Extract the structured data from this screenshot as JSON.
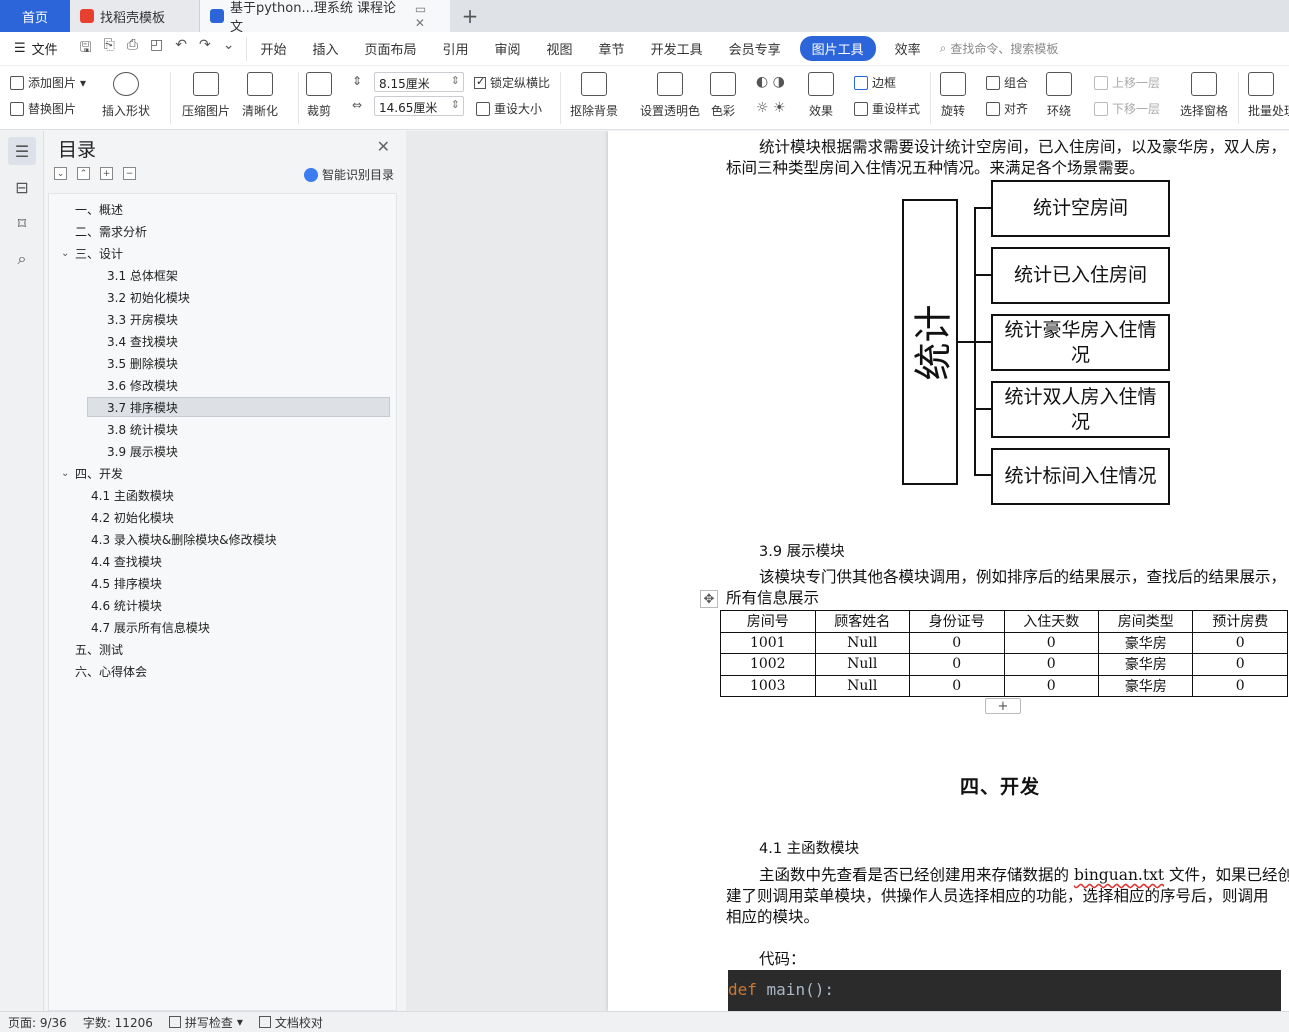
{
  "tabs": {
    "home": "首页",
    "doc1": "找稻壳模板",
    "doc2": "基于python...理系统 课程论文"
  },
  "menu": {
    "file": "文件",
    "items": [
      "开始",
      "插入",
      "页面布局",
      "引用",
      "审阅",
      "视图",
      "章节",
      "开发工具",
      "会员专享",
      "图片工具",
      "效率"
    ],
    "search_placeholder": "查找命令、搜索模板"
  },
  "ribbon": {
    "add_image": "添加图片",
    "replace_image": "替换图片",
    "insert_shape": "插入形状",
    "compress": "压缩图片",
    "clarity": "清晰化",
    "crop": "裁剪",
    "width": "8.15厘米",
    "height": "14.65厘米",
    "lock_ratio": "锁定纵横比",
    "reset_size": "重设大小",
    "remove_bg": "抠除背景",
    "transparent": "设置透明色",
    "color": "色彩",
    "effect": "效果",
    "border": "边框",
    "reset_style": "重设样式",
    "rotate": "旋转",
    "group": "组合",
    "align": "对齐",
    "up_layer": "上移一层",
    "down_layer": "下移一层",
    "wrap": "环绕",
    "select_pane": "选择窗格",
    "batch": "批量处理"
  },
  "toc": {
    "title": "目录",
    "smart": "智能识别目录",
    "items": [
      "一、概述",
      "二、需求分析",
      "三、设计",
      "3.1 总体框架",
      "3.2 初始化模块",
      "3.3 开房模块",
      "3.4 查找模块",
      "3.5 删除模块",
      "3.6 修改模块",
      "3.7 排序模块",
      "3.8 统计模块",
      "3.9 展示模块",
      "四、开发",
      "4.1 主函数模块",
      "4.2 初始化模块",
      "4.3 录入模块&删除模块&修改模块",
      "4.4 查找模块",
      "4.5 排序模块",
      "4.6 统计模块",
      "4.7 展示所有信息模块",
      "五、测试",
      "六、心得体会"
    ]
  },
  "doc": {
    "stat_para_1": "统计模块根据需求需要设计统计空房间，已入住房间，以及豪华房，双人房，",
    "stat_para_2": "标间三种类型房间入住情况五种情况。来满足各个场景需要。",
    "diagram": {
      "main": "统计",
      "boxes": [
        "统计空房间",
        "统计已入住房间",
        "统计豪华房入住情况",
        "统计双人房入住情况",
        "统计标间入住情况"
      ]
    },
    "h_3_9": "3.9 展示模块",
    "show_para_1": "该模块专门供其他各模块调用，例如排序后的结果展示，查找后的结果展示，",
    "show_para_2": "所有信息展示",
    "table": {
      "headers": [
        "房间号",
        "顾客姓名",
        "身份证号",
        "入住天数",
        "房间类型",
        "预计房费"
      ],
      "rows": [
        [
          "1001",
          "Null",
          "0",
          "0",
          "豪华房",
          "0"
        ],
        [
          "1002",
          "Null",
          "0",
          "0",
          "豪华房",
          "0"
        ],
        [
          "1003",
          "Null",
          "0",
          "0",
          "豪华房",
          "0"
        ]
      ]
    },
    "chapter_4": "四、开发",
    "h_4_1": "4.1 主函数模块",
    "main_para_1a": "主函数中先查看是否已经创建用来存储数据的 ",
    "main_para_1b": "binguan.txt",
    "main_para_1c": " 文件，如果已经创",
    "main_para_2": "建了则调用菜单模块，供操作人员选择相应的功能，选择相应的序号后，则调用",
    "main_para_3": "相应的模块。",
    "code_label": "代码：",
    "code_kw": "def",
    "code_rest": " main():"
  },
  "status": {
    "page": "页面: 9/36",
    "words": "字数: 11206",
    "spell": "拼写检查",
    "proof": "文档校对"
  }
}
